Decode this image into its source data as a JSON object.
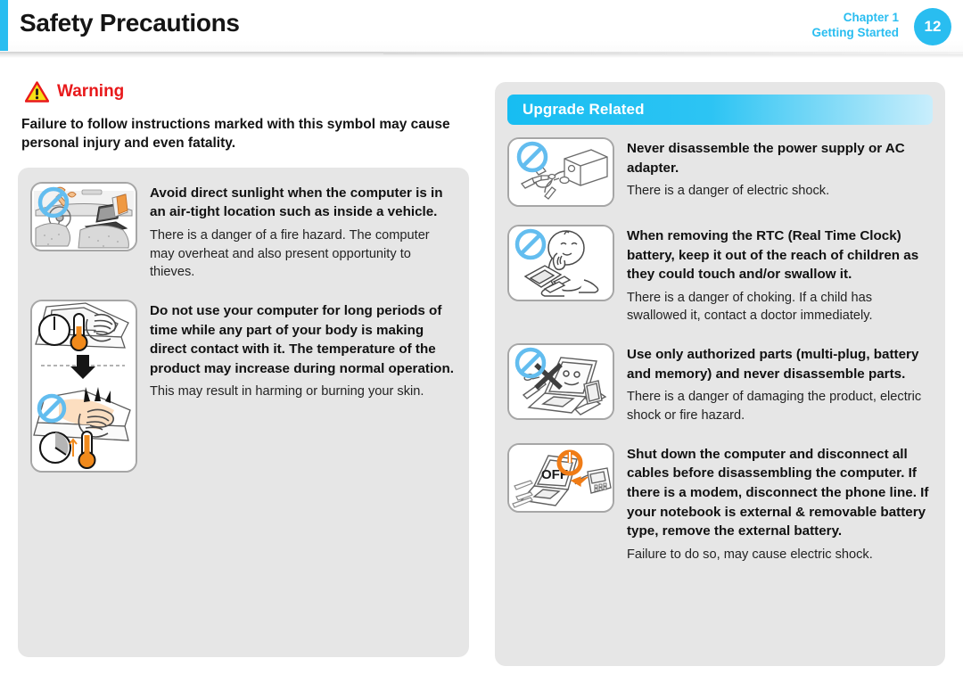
{
  "header": {
    "title": "Safety Precautions",
    "chapter": "Chapter 1",
    "chapter_section": "Getting Started",
    "page_number": "12",
    "accent_color": "#29bdf0"
  },
  "warning": {
    "icon": "warning-triangle-icon",
    "label": "Warning",
    "label_color": "#e8191b",
    "description": "Failure to follow instructions marked with this symbol may cause personal injury and even fatality."
  },
  "left_column": {
    "items": [
      {
        "icon": "laptop-in-car-sunlight-icon",
        "title": "Avoid direct sunlight when the computer is in an air-tight location such as inside a vehicle.",
        "body": "There is a danger of a fire hazard. The computer may overheat and also present opportunity to thieves."
      },
      {
        "icon": "laptop-heat-burn-skin-icon",
        "title": "Do not use your computer for long periods of time while any part of your body is making direct contact with it. The temperature of the product may increase during normal operation.",
        "body": "This may result in harming or burning your skin."
      }
    ]
  },
  "right_column": {
    "section_title": "Upgrade Related",
    "section_color": "#17bdf2",
    "items": [
      {
        "icon": "ac-adapter-disassemble-prohibited-icon",
        "title": "Never disassemble the power supply or AC adapter.",
        "body": "There is a danger of electric shock."
      },
      {
        "icon": "child-swallow-rtc-battery-prohibited-icon",
        "title": "When removing the RTC (Real Time Clock) battery, keep it out of the reach of children as they could touch and/or swallow it.",
        "body": "There is a danger of choking. If a child has swallowed it, contact a doctor immediately."
      },
      {
        "icon": "unauthorized-parts-prohibited-icon",
        "title": "Use only authorized parts (multi-plug, battery and memory) and never disassemble parts.",
        "body": "There is a danger of damaging the product, electric shock or fire hazard."
      },
      {
        "icon": "shutdown-disconnect-cables-icon",
        "title": "Shut down the computer and disconnect all cables before disassembling the computer. If there is a modem, disconnect the phone line. If your notebook is external & removable battery type, remove the external battery.",
        "body": "Failure to do so, may cause electric shock."
      }
    ]
  }
}
